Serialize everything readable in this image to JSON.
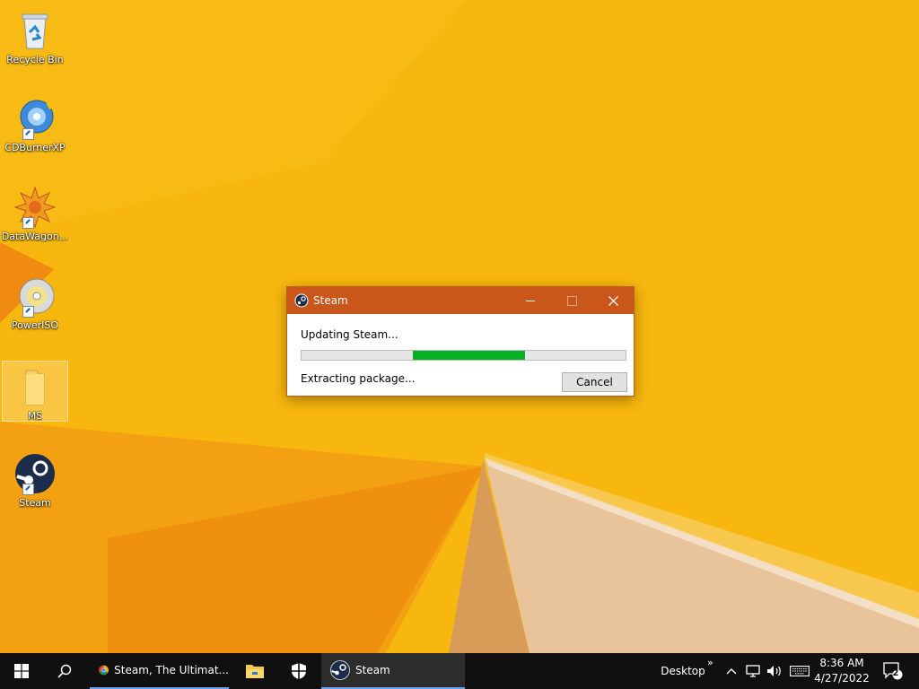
{
  "desktop": {
    "icons": [
      {
        "label": "Recycle Bin",
        "icon": "recycle-bin-icon"
      },
      {
        "label": "CDBurnerXP",
        "icon": "cdburnerxp-icon"
      },
      {
        "label": "DataWagon...",
        "icon": "datawagon-icon"
      },
      {
        "label": "PowerISO",
        "icon": "poweriso-icon"
      },
      {
        "label": "MS",
        "icon": "folder-icon"
      },
      {
        "label": "Steam",
        "icon": "steam-icon"
      }
    ]
  },
  "dialog": {
    "title": "Steam",
    "status": "Updating Steam...",
    "substatus": "Extracting package...",
    "cancel_label": "Cancel",
    "progress": {
      "start": 0.344,
      "end": 0.691
    },
    "accent_color": "#c9561b",
    "progress_color": "#06b025"
  },
  "taskbar": {
    "start": "windows-start-icon",
    "search": "search-icon",
    "apps": [
      {
        "label": "Steam, The Ultimat...",
        "icon": "chrome-icon"
      },
      {
        "label": "",
        "icon": "file-explorer-icon"
      },
      {
        "label": "",
        "icon": "defender-shield-icon"
      },
      {
        "label": "Steam",
        "icon": "steam-icon"
      }
    ],
    "desktop_label": "Desktop",
    "time": "8:36 AM",
    "date": "4/27/2022",
    "notification_count": "2"
  }
}
